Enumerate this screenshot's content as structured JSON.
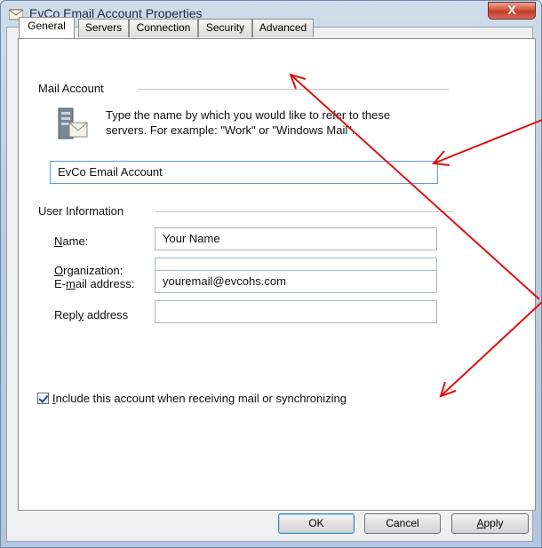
{
  "window": {
    "title": "EvCo Email Account Properties",
    "close": "X"
  },
  "tabs": [
    {
      "label": "General"
    },
    {
      "label": "Servers"
    },
    {
      "label": "Connection"
    },
    {
      "label": "Security"
    },
    {
      "label": "Advanced"
    }
  ],
  "mail_account": {
    "heading": "Mail Account",
    "description_line1": "Type the name by which you would like to refer to these",
    "description_line2": "servers.  For example: \"Work\" or \"Windows Mail\".",
    "account_name": "EvCo Email Account"
  },
  "user_information": {
    "heading": "User Information",
    "name_label_mn": "N",
    "name_label_rest": "ame:",
    "name_value": "Your Name",
    "org_label_mn": "O",
    "org_label_rest": "rganization:",
    "org_value": "",
    "email_label_pre": "E-",
    "email_label_mn": "m",
    "email_label_rest": "ail address:",
    "email_value": "youremail@evcohs.com",
    "reply_label_pre": "Repl",
    "reply_label_mn": "y",
    "reply_label_rest": " address",
    "reply_value": ""
  },
  "include_checkbox": {
    "checked": true,
    "label_mn": "I",
    "label_rest": "nclude this account when receiving mail or synchronizing"
  },
  "buttons": {
    "ok": "OK",
    "cancel": "Cancel",
    "apply_mn": "A",
    "apply_rest": "pply"
  },
  "colors": {
    "annotation_arrows": "#e01010"
  }
}
